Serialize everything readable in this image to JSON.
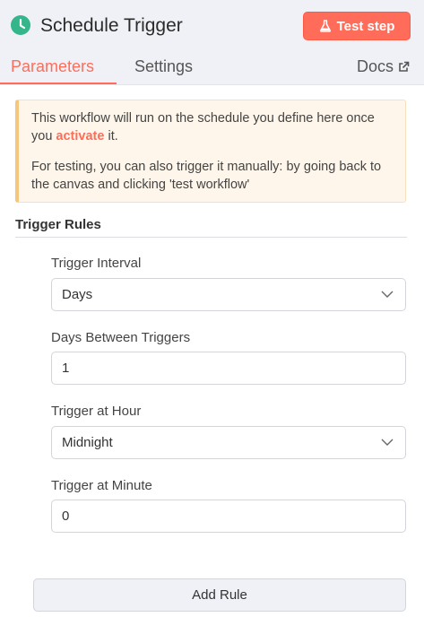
{
  "header": {
    "title": "Schedule Trigger",
    "trigger_icon": "clock-icon",
    "test_button_icon": "flask-icon",
    "test_button_label": "Test step",
    "accent_color": "#ff6d5a"
  },
  "tabs": [
    {
      "label": "Parameters",
      "active": true
    },
    {
      "label": "Settings",
      "active": false
    },
    {
      "label": "Docs",
      "active": false,
      "icon": "external-link-icon"
    }
  ],
  "notice": {
    "line1_prefix": "This workflow will run on the schedule you define here once you",
    "line1_link": "activate",
    "line1_suffix": "it.",
    "line2": "For testing, you can also trigger it manually: by going back to the canvas and clicking 'test workflow'"
  },
  "section": {
    "title": "Trigger Rules"
  },
  "fields": [
    {
      "label": "Trigger Interval",
      "value": "Days",
      "type": "select"
    },
    {
      "label": "Days Between Triggers",
      "value": "1",
      "type": "number"
    },
    {
      "label": "Trigger at Hour",
      "value": "Midnight",
      "type": "select"
    },
    {
      "label": "Trigger at Minute",
      "value": "0",
      "type": "number"
    }
  ],
  "add_rule_label": "Add Rule"
}
